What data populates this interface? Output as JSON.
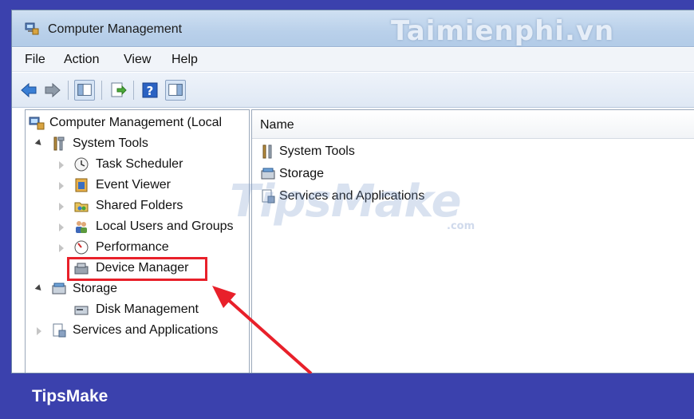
{
  "window": {
    "title": "Computer Management",
    "title_watermark": "Taimienphi.vn"
  },
  "menu": {
    "items": [
      "File",
      "Action",
      "View",
      "Help"
    ]
  },
  "toolbar": {
    "buttons": [
      "back-icon",
      "forward-icon",
      "show-hide-console-tree-icon",
      "export-list-icon",
      "help-icon",
      "show-action-pane-icon"
    ]
  },
  "tree": {
    "root": "Computer Management (Local",
    "items": [
      {
        "label": "System Tools",
        "expanded": true
      },
      {
        "label": "Task Scheduler"
      },
      {
        "label": "Event Viewer"
      },
      {
        "label": "Shared Folders"
      },
      {
        "label": "Local Users and Groups"
      },
      {
        "label": "Performance"
      },
      {
        "label": "Device Manager",
        "highlighted": true
      },
      {
        "label": "Storage",
        "expanded": true
      },
      {
        "label": "Disk Management"
      },
      {
        "label": "Services and Applications"
      }
    ]
  },
  "list": {
    "column_header": "Name",
    "rows": [
      "System Tools",
      "Storage",
      "Services and Applications"
    ]
  },
  "watermark": {
    "text": "TipsMake",
    "suffix": ".com"
  },
  "footer": {
    "brand": "TipsMake"
  },
  "colors": {
    "highlight": "#e8202a",
    "frame": "#3b41ad"
  }
}
